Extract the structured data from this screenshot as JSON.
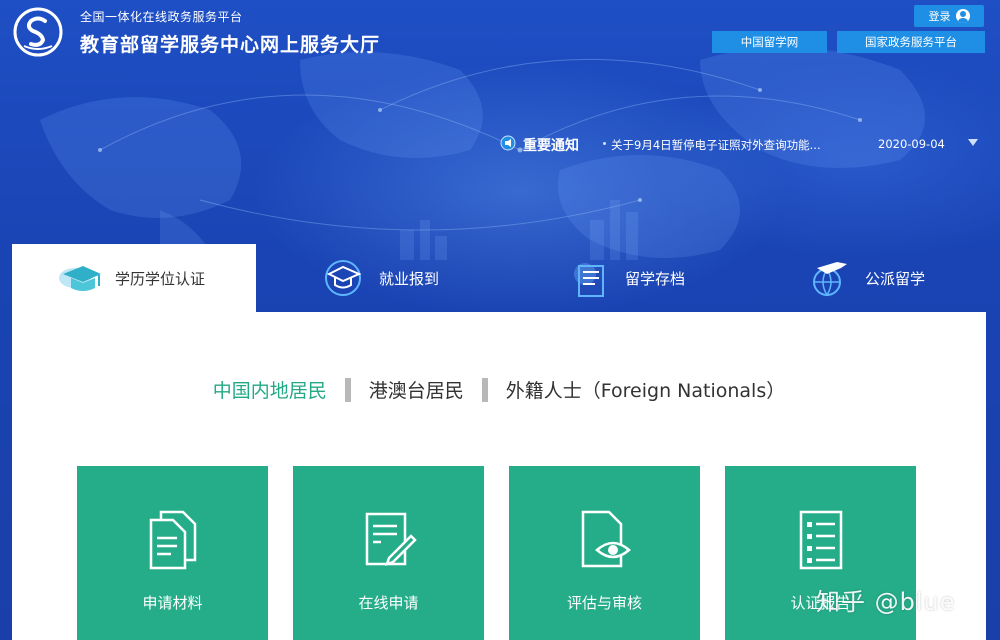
{
  "header": {
    "platform_text": "全国一体化在线政务服务平台",
    "site_title": "教育部留学服务中心网上服务大厅",
    "login_label": "登录",
    "links": [
      "中国留学网",
      "国家政务服务平台"
    ]
  },
  "notice": {
    "label": "重要通知",
    "text": "关于9月4日暂停电子证照对外查询功能...",
    "date": "2020-09-04"
  },
  "tabs": [
    {
      "label": "学历学位认证",
      "icon": "graduation-cap-icon",
      "active": true
    },
    {
      "label": "就业报到",
      "icon": "graduation-hat-icon",
      "active": false
    },
    {
      "label": "留学存档",
      "icon": "archive-folder-icon",
      "active": false
    },
    {
      "label": "公派留学",
      "icon": "plane-globe-icon",
      "active": false
    }
  ],
  "categories": [
    {
      "label": "中国内地居民",
      "active": true
    },
    {
      "label": "港澳台居民",
      "active": false
    },
    {
      "label": "外籍人士（Foreign Nationals）",
      "active": false
    }
  ],
  "steps": [
    {
      "label": "申请材料",
      "icon": "documents-icon"
    },
    {
      "label": "在线申请",
      "icon": "edit-form-icon"
    },
    {
      "label": "评估与审核",
      "icon": "document-eye-icon"
    },
    {
      "label": "认证报告",
      "icon": "checklist-report-icon"
    }
  ],
  "watermark": "知乎 @blue",
  "colors": {
    "background": "#1a3fa8",
    "link_button": "#1f8fe6",
    "accent_green": "#25ad8a",
    "active_category": "#24a986"
  }
}
